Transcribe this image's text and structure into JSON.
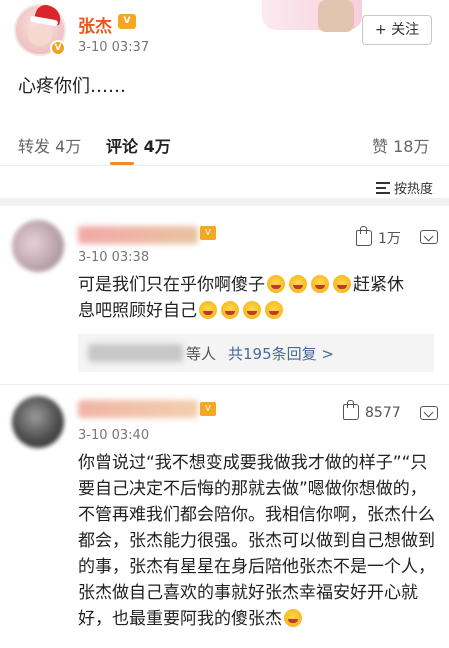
{
  "post": {
    "author": "张杰",
    "vip_badge": "V",
    "avatar_badge": "V",
    "time": "3-10 03:37",
    "follow_label": "+ 关注",
    "text": "心疼你们……"
  },
  "tabs": {
    "repost": "转发 4万",
    "comment": "评论 4万",
    "like": "赞 18万"
  },
  "sort": {
    "label": "按热度"
  },
  "comments": [
    {
      "time": "3-10 03:38",
      "likes": "1万",
      "text_line1": "可是我们只在乎你啊傻子",
      "text_line1_tail": "赶紧休",
      "text_line2": "息吧照顾好自己",
      "replies_suffix": "等人",
      "replies_link": "共195条回复 >"
    },
    {
      "time": "3-10 03:40",
      "likes": "8577",
      "text": "你曾说过“我不想变成要我做我才做的样子”“只要自己决定不后悔的那就去做”嗯做你想做的，不管再难我们都会陪你。我相信你啊，张杰什么都会，张杰能力很强。张杰可以做到自己想做到的事，张杰有星星在身后陪他张杰不是一个人，张杰做自己喜欢的事就好张杰幸福安好开心就好，也最重要阿我的傻张杰"
    }
  ],
  "colors": {
    "author_name": "#e8581a",
    "reply_link": "#4a6a96",
    "tab_indicator": "#f08a2c",
    "vip_badge": "#f5a623"
  },
  "icons": [
    "verified-icon",
    "vip-icon",
    "sort-icon",
    "like-thumb-icon",
    "comment-more-icon",
    "emoji-cry-icon"
  ]
}
